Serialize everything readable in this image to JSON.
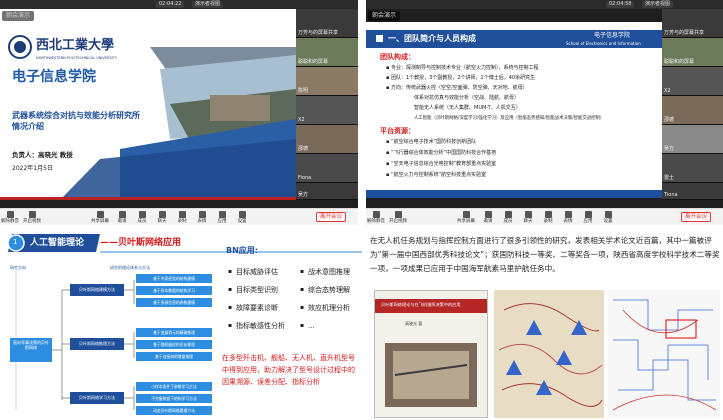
{
  "q1": {
    "speaker": "朝会演示",
    "clock": "02:04:22",
    "screenshare": "演示者视图",
    "slide": {
      "school": "西北工業大學",
      "school_en": "NORTHWESTERN POLYTECHNICAL UNIVERSITY",
      "college": "电子信息学院",
      "title_line1": "武器系统综合对抗与效能分析研究所",
      "title_line2": "情况介绍",
      "presenter": "负责人：高晓光 教授",
      "date": "2022年1月5日"
    },
    "participants": [
      "万芳与的屏幕共享",
      "聪聪和的屏幕",
      "陈明",
      "X2",
      "邵德",
      "Fiona",
      "吴方"
    ],
    "toolbar": [
      "解除静音",
      "开启视频",
      "共享屏幕",
      "邀请",
      "成员",
      "聊天",
      "录制",
      "表情",
      "应用",
      "设置"
    ],
    "leave": "离开会议"
  },
  "q2": {
    "speaker": "朝会演示",
    "clock": "02:04:58",
    "screenshare": "演示者视图",
    "slide": {
      "section_no": "一、",
      "section": "团队简介与人员构成",
      "college": "电子信息学院",
      "college_en": "School of Electronics and Information",
      "h1": "团队构成：",
      "lines": [
        "▪ 专业：探测制导与控制技术专业（航空火力控制），系统与控制工程",
        "▪ 团队：1个教授，3个副教授，2个讲师，1个博士后，40余研究生",
        "▪ 方向：传统武器火控（空空/空面弹、防空弹、天对地、航母）",
        "体系对抗仿真与效能分析（空战、陆航、航母）",
        "智能无人系统（无人集群、MUM-T、人机交互）",
        "人工智能（贝叶斯网络/深度学习/强化学习）及应用（智能态势感知/智能战术决策/智能交战控制）"
      ],
      "h2": "平台资源：",
      "platforms": [
        "▪ “航空综合电子技术”国防科技创新团队",
        "▪ “飞行器综合体效能分析”中国国防科技合作基地",
        "▪ “空天电子信息综合光电控制”教育部重点实验室",
        "▪ “航空火力与控制系统”航空科技重点实验室"
      ]
    },
    "participants": [
      "万芳与的屏幕共享",
      "聪聪和的屏幕",
      "X2",
      "邵德",
      "吴方",
      "雷士",
      "Tiona"
    ],
    "toolbar": [
      "解除静音",
      "开启视频",
      "共享屏幕",
      "邀请",
      "成员",
      "聊天",
      "录制",
      "表情",
      "应用",
      "设置"
    ],
    "leave": "离开会议"
  },
  "q3": {
    "title": "人工智能理论",
    "subtitle": "——贝叶斯网络应用",
    "diagram": {
      "left_head": "研究方向",
      "mid_head": "研究的理论体系与方法",
      "root": "面向军事决策的贝叶斯网络",
      "groups": [
        "贝叶斯网络建模方法",
        "贝叶斯网络推理方法",
        "贝叶斯网络学习方法"
      ],
      "items": [
        "基于专家经验的结构建模",
        "基于样本数据的结构学习",
        "基于多源信息的参数建模",
        "基于变量消元的精确推理",
        "基于随机抽样的近似推理",
        "基于连接树的增量推理",
        "小样本条件下参数学习方法",
        "不完备数据下结构学习方法",
        "动态贝叶斯网络建模方法"
      ]
    },
    "bn_head": "BN应用:",
    "bn_col1": [
      "目标威胁评估",
      "目标类型识别",
      "故障要素诊断",
      "指标敏感性分析"
    ],
    "bn_col2": [
      "战术意图推理",
      "综合态势理解",
      "效应机理分析",
      "..."
    ],
    "para": "在多型歼击机、舰船、无人机、直升机型号中得到应用，助力解决了型号设计过程中的因果溯源、误差分配、指标分析"
  },
  "q4": {
    "text": "在无人机任务规划与指挥控制方面进行了很多引领性的研究，发表相关学术论文近百篇，其中一篇被评为“第一届中国西部优秀科技论文”；获国防科技一等奖、二等奖各一项，陕西省高度学校科学技术二等奖一项，一项成果已应用于中国海军航素马里护航任务中。",
    "book_title": "贝叶斯网络理论与在飞机指挥决策中的应用",
    "book_author": "高晓光 著"
  },
  "colors": {
    "red": "#d31c1c",
    "blue": "#1f4e9b",
    "bluebox": "#2d8de0"
  }
}
